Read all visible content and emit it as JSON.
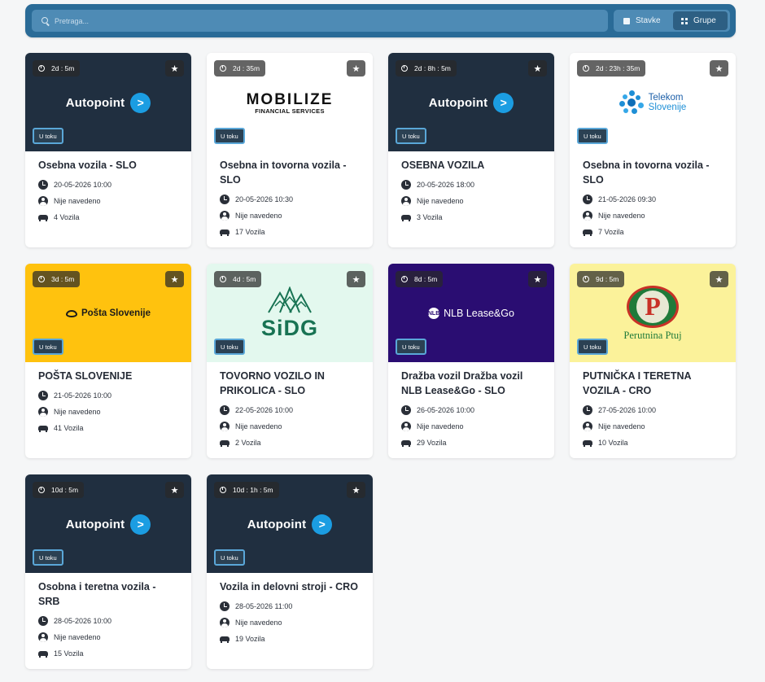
{
  "search": {
    "placeholder": "Pretraga..."
  },
  "view_toggle": {
    "items_label": "Stavke",
    "groups_label": "Grupe",
    "active": "Grupe"
  },
  "status_text": "U toku",
  "colors": {
    "topbar": "#2a6b97",
    "status_border": "#5aa7d8",
    "autopoint_bg": "#202f40",
    "posta_bg": "#ffc20e",
    "sidg_bg": "#e3f8ee",
    "nlb_bg": "#2a0d72",
    "perutnina_bg": "#fbf29a"
  },
  "cards": [
    {
      "timer": "2d : 5m",
      "logo": "Autopoint",
      "title": "Osebna vozila - SLO",
      "date": "20-05-2026 10:00",
      "person": "Nije navedeno",
      "vehicles": "4 Vozila"
    },
    {
      "timer": "2d : 35m",
      "logo": "MOBILIZE",
      "logo_sub": "FINANCIAL SERVICES",
      "title": "Osebna in tovorna vozila - SLO",
      "date": "20-05-2026 10:30",
      "person": "Nije navedeno",
      "vehicles": "17 Vozila"
    },
    {
      "timer": "2d : 8h : 5m",
      "logo": "Autopoint",
      "title": "OSEBNA VOZILA",
      "date": "20-05-2026 18:00",
      "person": "Nije navedeno",
      "vehicles": "3 Vozila"
    },
    {
      "timer": "2d : 23h : 35m",
      "logo": "Telekom",
      "logo_sub": "Slovenije",
      "title": "Osebna in tovorna vozila - SLO",
      "date": "21-05-2026 09:30",
      "person": "Nije navedeno",
      "vehicles": "7 Vozila"
    },
    {
      "timer": "3d : 5m",
      "logo": "Pošta Slovenije",
      "title": "POŠTA SLOVENIJE",
      "date": "21-05-2026 10:00",
      "person": "Nije navedeno",
      "vehicles": "41 Vozila"
    },
    {
      "timer": "4d : 5m",
      "logo": "SiDG",
      "title": "TOVORNO VOZILO IN PRIKOLICA - SLO",
      "date": "22-05-2026 10:00",
      "person": "Nije navedeno",
      "vehicles": "2 Vozila"
    },
    {
      "timer": "8d : 5m",
      "logo": "NLB Lease&Go",
      "logo_mark": "NLB",
      "title": "Dražba vozil Dražba vozil NLB Lease&Go - SLO",
      "date": "26-05-2026 10:00",
      "person": "Nije navedeno",
      "vehicles": "29 Vozila"
    },
    {
      "timer": "9d : 5m",
      "logo": "Perutnina Ptuj",
      "logo_mark": "P",
      "title": "PUTNIČKA I TERETNA VOZILA - CRO",
      "date": "27-05-2026 10:00",
      "person": "Nije navedeno",
      "vehicles": "10 Vozila"
    },
    {
      "timer": "10d : 5m",
      "logo": "Autopoint",
      "title": "Osobna i teretna vozila - SRB",
      "date": "28-05-2026 10:00",
      "person": "Nije navedeno",
      "vehicles": "15 Vozila"
    },
    {
      "timer": "10d : 1h : 5m",
      "logo": "Autopoint",
      "title": "Vozila in delovni stroji - CRO",
      "date": "28-05-2026 11:00",
      "person": "Nije navedeno",
      "vehicles": "19 Vozila"
    }
  ]
}
